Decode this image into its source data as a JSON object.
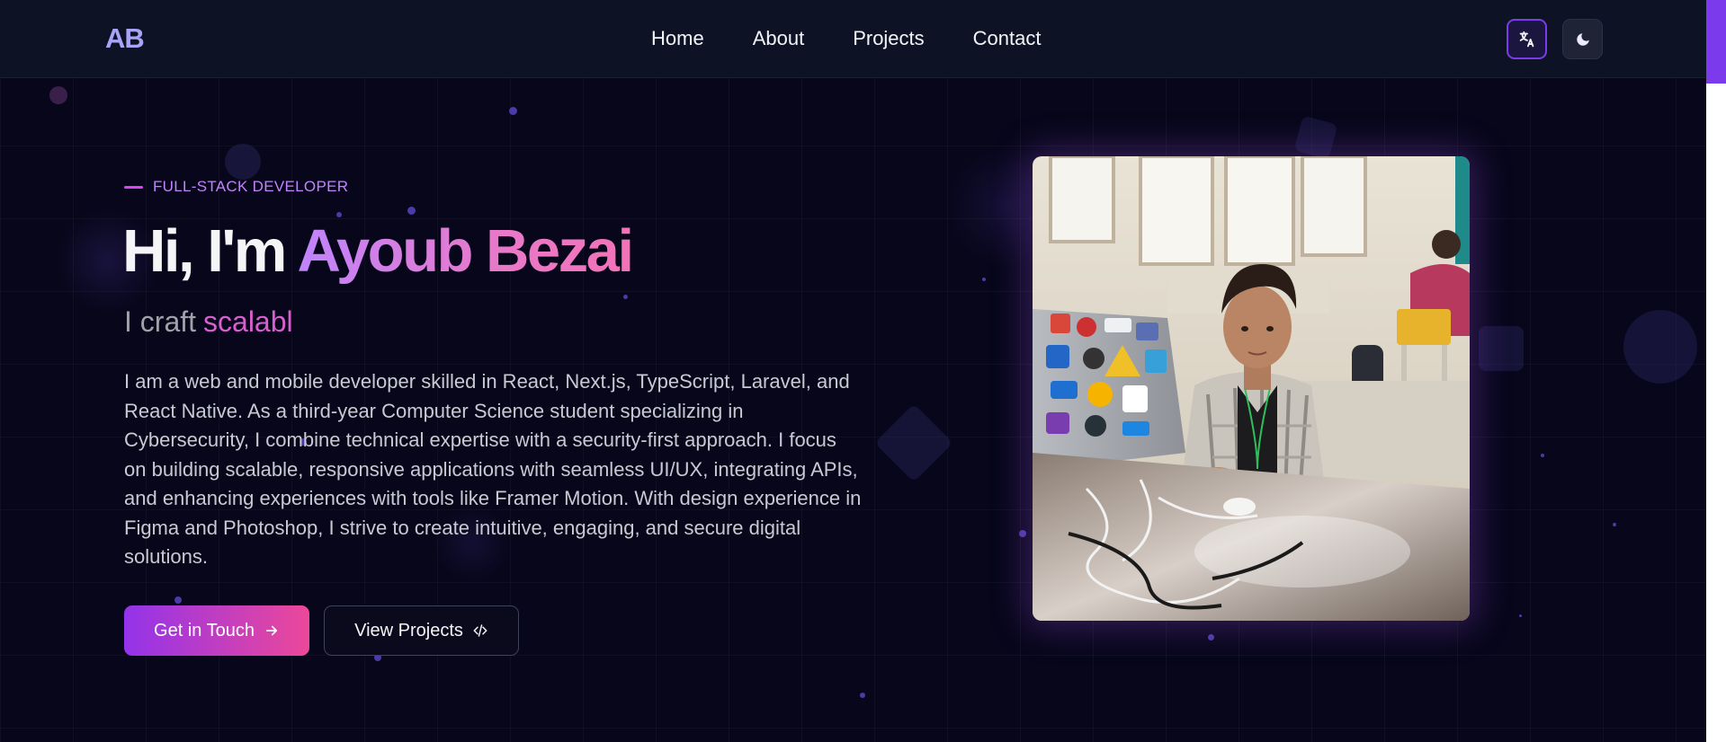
{
  "nav": {
    "logo": "AB",
    "links": [
      "Home",
      "About",
      "Projects",
      "Contact"
    ]
  },
  "hero": {
    "eyebrow": "FULL-STACK DEVELOPER",
    "headline_prefix": "Hi, I'm ",
    "headline_name": "Ayoub Bezai",
    "typed_prefix": "I craft",
    "typed_word": "scalabl",
    "bio": "I am a web and mobile developer skilled in React, Next.js, TypeScript, Laravel, and React Native. As a third-year Computer Science student specializing in Cybersecurity, I combine technical expertise with a security-first approach. I focus on building scalable, responsive applications with seamless UI/UX, integrating APIs, and enhancing experiences with tools like Framer Motion. With design experience in Figma and Photoshop, I strive to create intuitive, engaging, and secure digital solutions.",
    "primary_button": "Get in Touch",
    "secondary_button": "View Projects"
  },
  "icons": {
    "translate": "translate-icon",
    "theme": "moon-icon",
    "arrow": "arrow-right-icon",
    "code": "code-icon"
  },
  "colors": {
    "background": "#07061a",
    "navbar": "#0d1224",
    "accent_purple": "#9333ea",
    "accent_pink": "#ec4899"
  }
}
